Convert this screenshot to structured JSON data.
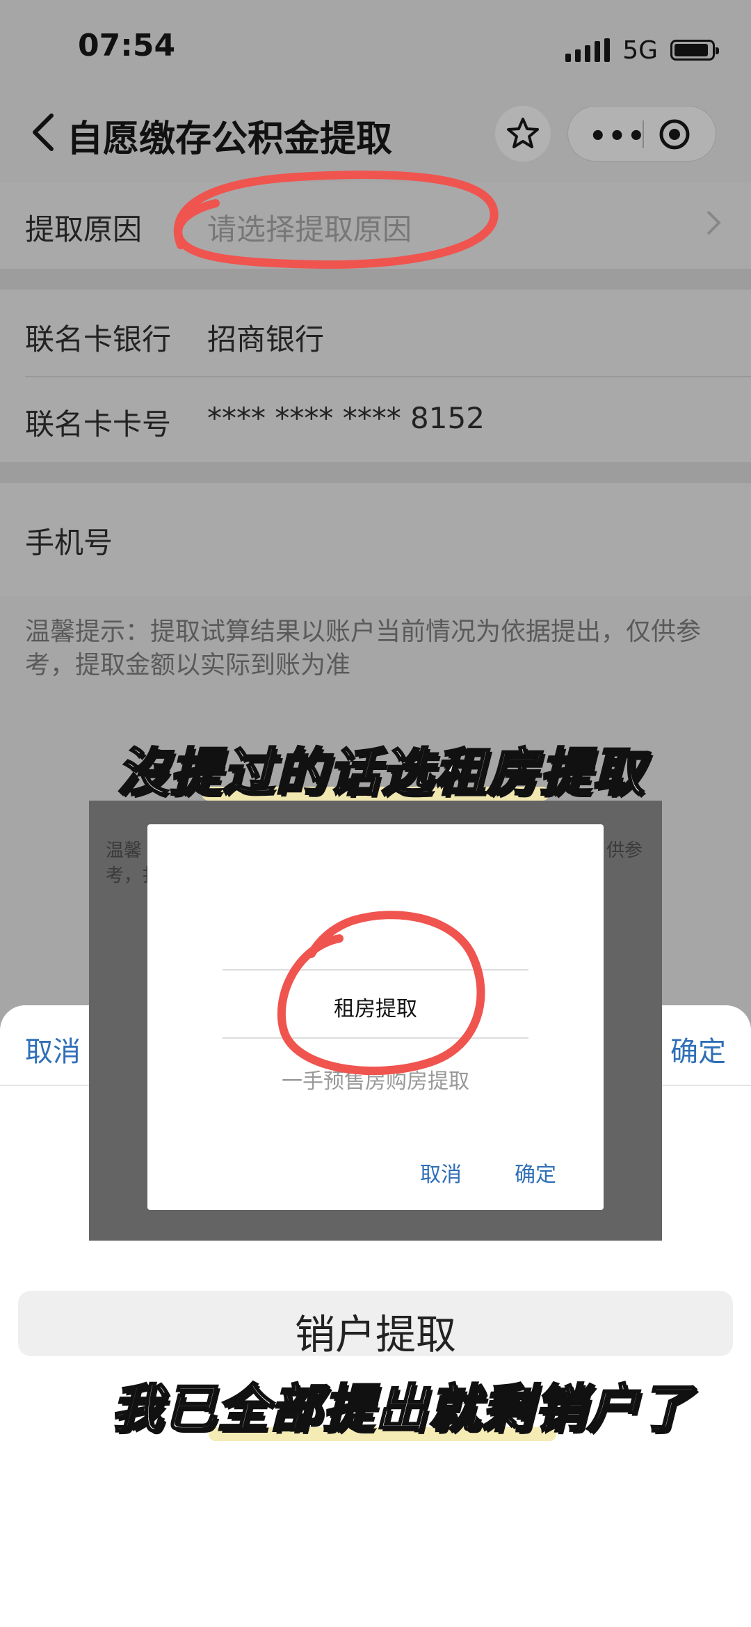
{
  "status_bar": {
    "time": "07:54",
    "network": "5G"
  },
  "nav": {
    "title": "自愿缴存公积金提取",
    "favorite_icon": "star-icon",
    "more_icon": "more-dots-icon",
    "close_icon": "record-target-icon"
  },
  "form": {
    "reason": {
      "label": "提取原因",
      "placeholder": "请选择提取原因"
    },
    "bank": {
      "label": "联名卡银行",
      "value": "招商银行"
    },
    "card": {
      "label": "联名卡卡号",
      "value": "**** **** **** 8152"
    },
    "phone": {
      "label": "手机号",
      "value": ""
    }
  },
  "tip": "温馨提示：提取试算结果以账户当前情况为依据提出，仅供参考，提取金额以实际到账为准",
  "captions": {
    "top": "沒提过的话选租房提取",
    "bottom": "我已全部提出就剩销户了"
  },
  "sheet": {
    "cancel": "取消",
    "confirm": "确定",
    "selected_option": "销户提取"
  },
  "inset": {
    "tip_left_line1": "温馨",
    "tip_left_line2": "考，扌",
    "tip_right_line1": "供参",
    "selected_option": "租房提取",
    "next_option": "一手预售房购房提取",
    "cancel": "取消",
    "confirm": "确定"
  },
  "colors": {
    "link_blue": "#2f6fb7",
    "annotation_red": "#f0544f",
    "caption_highlight": "#f4eab0"
  }
}
